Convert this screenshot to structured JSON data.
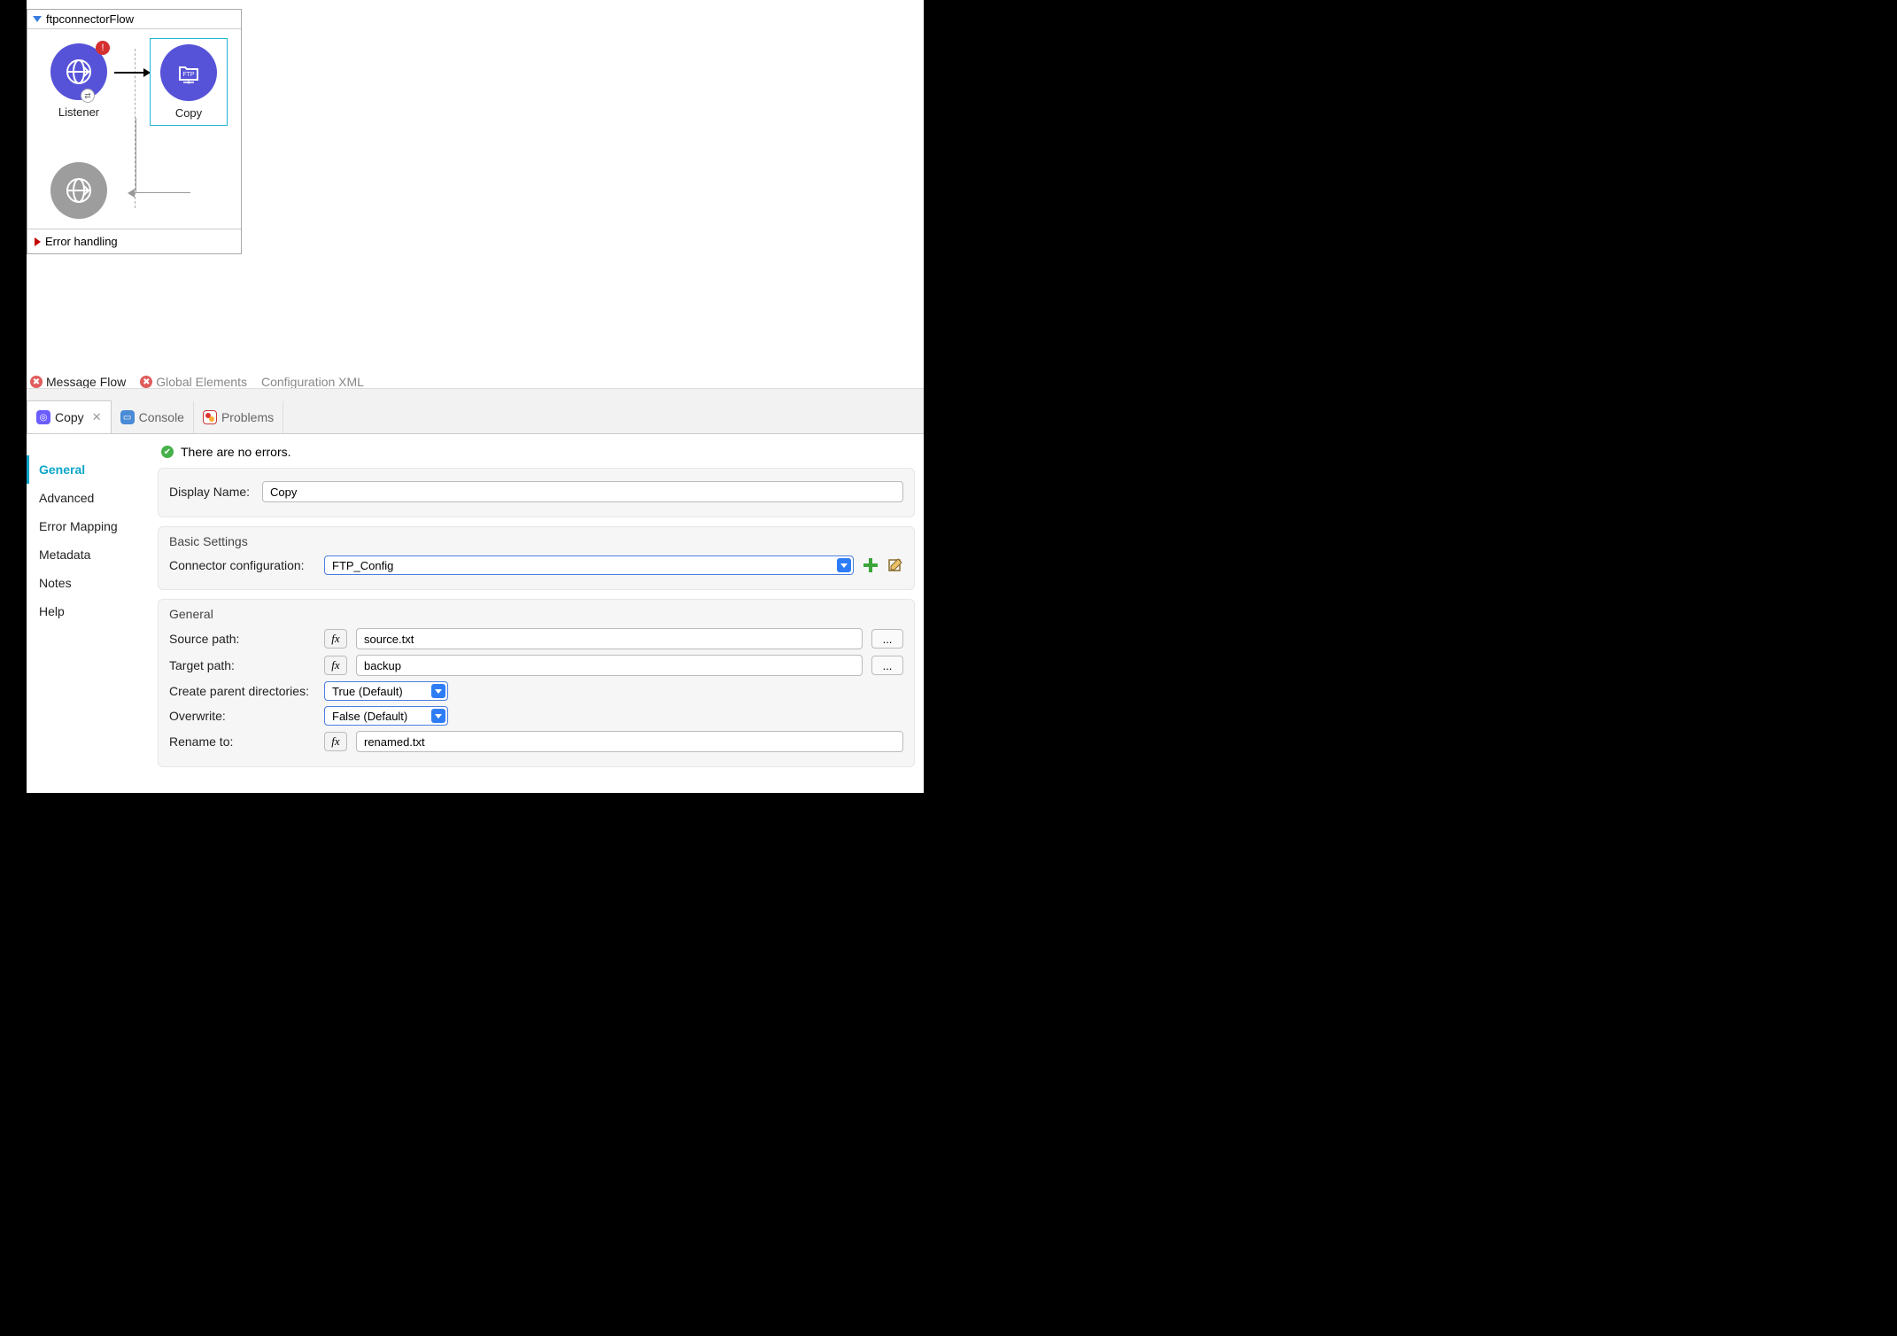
{
  "flow": {
    "name": "ftpconnectorFlow",
    "nodes": {
      "listener": "Listener",
      "copy": "Copy"
    },
    "error_section": "Error handling"
  },
  "editor_tabs": {
    "message_flow": "Message Flow",
    "global_elements": "Global Elements",
    "config_xml": "Configuration XML"
  },
  "lower_tabs": {
    "copy": "Copy",
    "console": "Console",
    "problems": "Problems"
  },
  "props_sidebar": {
    "general": "General",
    "advanced": "Advanced",
    "error_mapping": "Error Mapping",
    "metadata": "Metadata",
    "notes": "Notes",
    "help": "Help"
  },
  "status": {
    "no_errors": "There are no errors."
  },
  "form": {
    "display_name_label": "Display Name:",
    "display_name_value": "Copy",
    "basic_settings_title": "Basic Settings",
    "connector_config_label": "Connector configuration:",
    "connector_config_value": "FTP_Config",
    "general_title": "General",
    "source_path_label": "Source path:",
    "source_path_value": "source.txt",
    "target_path_label": "Target path:",
    "target_path_value": "backup",
    "create_parent_label": "Create parent directories:",
    "create_parent_value": "True (Default)",
    "overwrite_label": "Overwrite:",
    "overwrite_value": "False (Default)",
    "rename_to_label": "Rename to:",
    "rename_to_value": "renamed.txt",
    "browse_label": "...",
    "fx_label": "fx"
  }
}
